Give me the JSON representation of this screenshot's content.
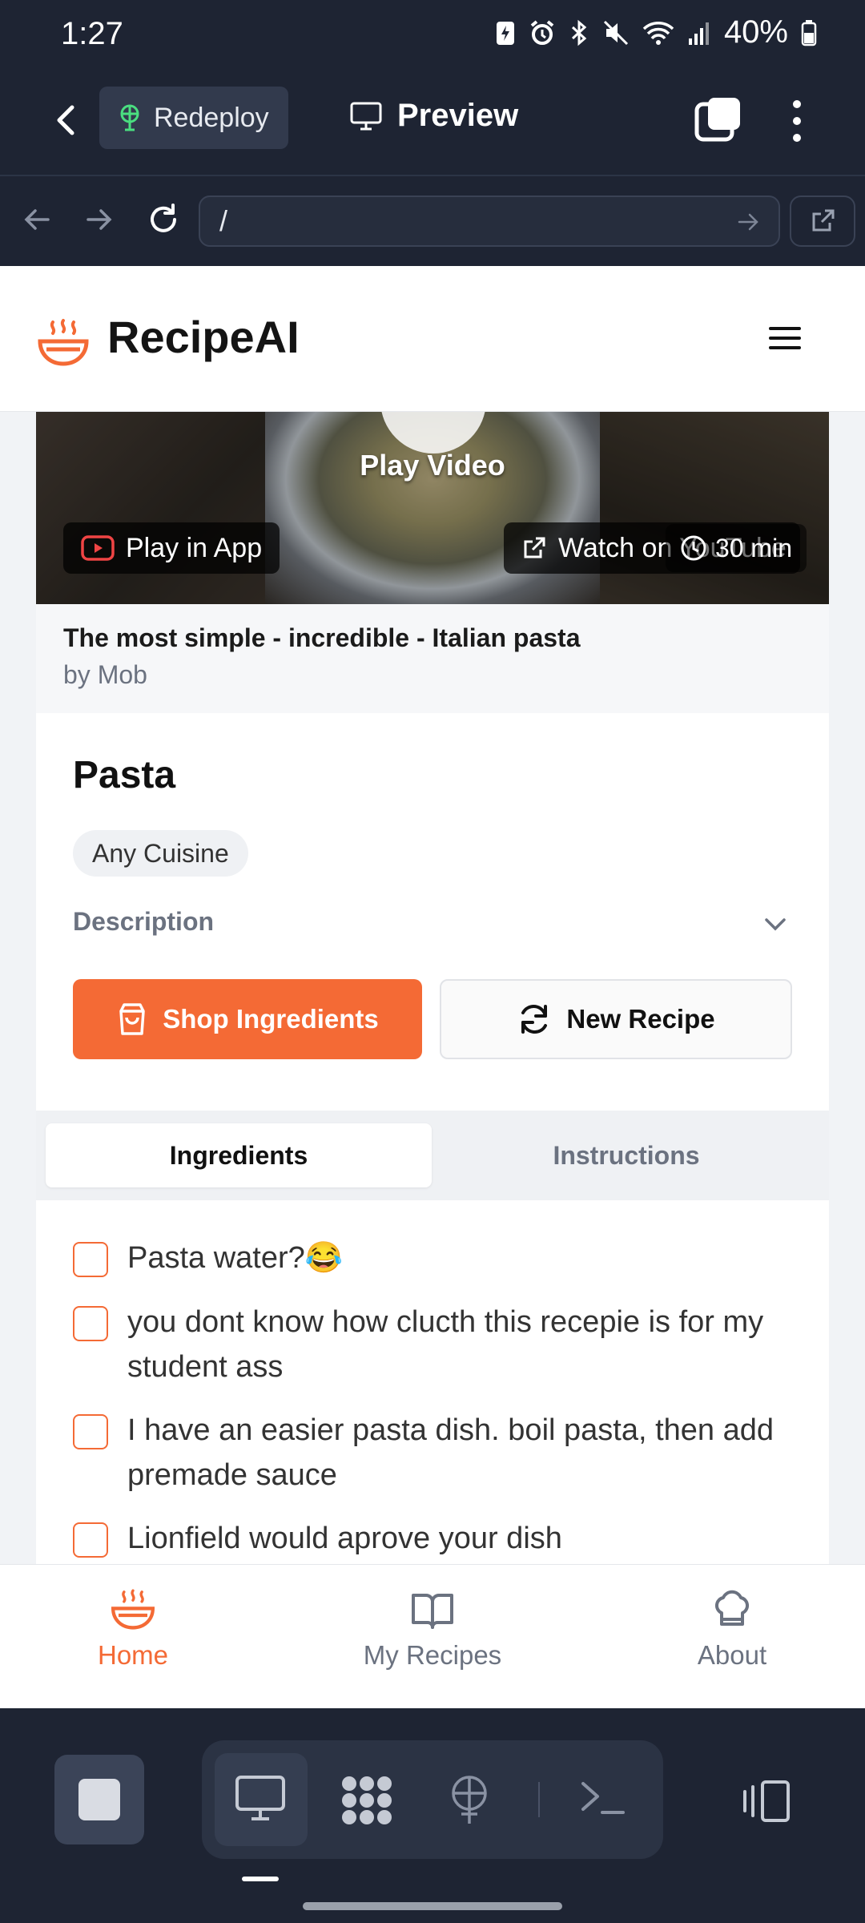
{
  "status_bar": {
    "time": "1:27",
    "battery": "40%"
  },
  "app_bar": {
    "redeploy_label": "Redeploy",
    "preview_label": "Preview"
  },
  "url_bar": {
    "url": "/"
  },
  "header": {
    "brand": "RecipeAI"
  },
  "video": {
    "play_video_label": "Play Video",
    "play_in_app_label": "Play in App",
    "watch_label": "Watch on YouTube",
    "duration": "30 min",
    "title": "The most simple - incredible - Italian pasta",
    "author": "by Mob"
  },
  "recipe": {
    "name": "Pasta",
    "cuisine": "Any Cuisine",
    "description_label": "Description",
    "shop_label": "Shop Ingredients",
    "new_recipe_label": "New Recipe"
  },
  "tabs": {
    "ingredients": "Ingredients",
    "instructions": "Instructions"
  },
  "ingredients": [
    {
      "text": "Pasta water?😂",
      "checked": false
    },
    {
      "text": "you dont know how clucth this recepie is for my student ass",
      "checked": false
    },
    {
      "text": "I have an easier pasta dish. boil pasta, then add premade sauce",
      "checked": false
    },
    {
      "text": "Lionfield would aprove your dish",
      "checked": false
    }
  ],
  "bottom_nav": {
    "home": "Home",
    "my_recipes": "My Recipes",
    "about": "About",
    "active": "Home"
  },
  "colors": {
    "accent": "#f46a35",
    "chrome": "#1e2433"
  }
}
